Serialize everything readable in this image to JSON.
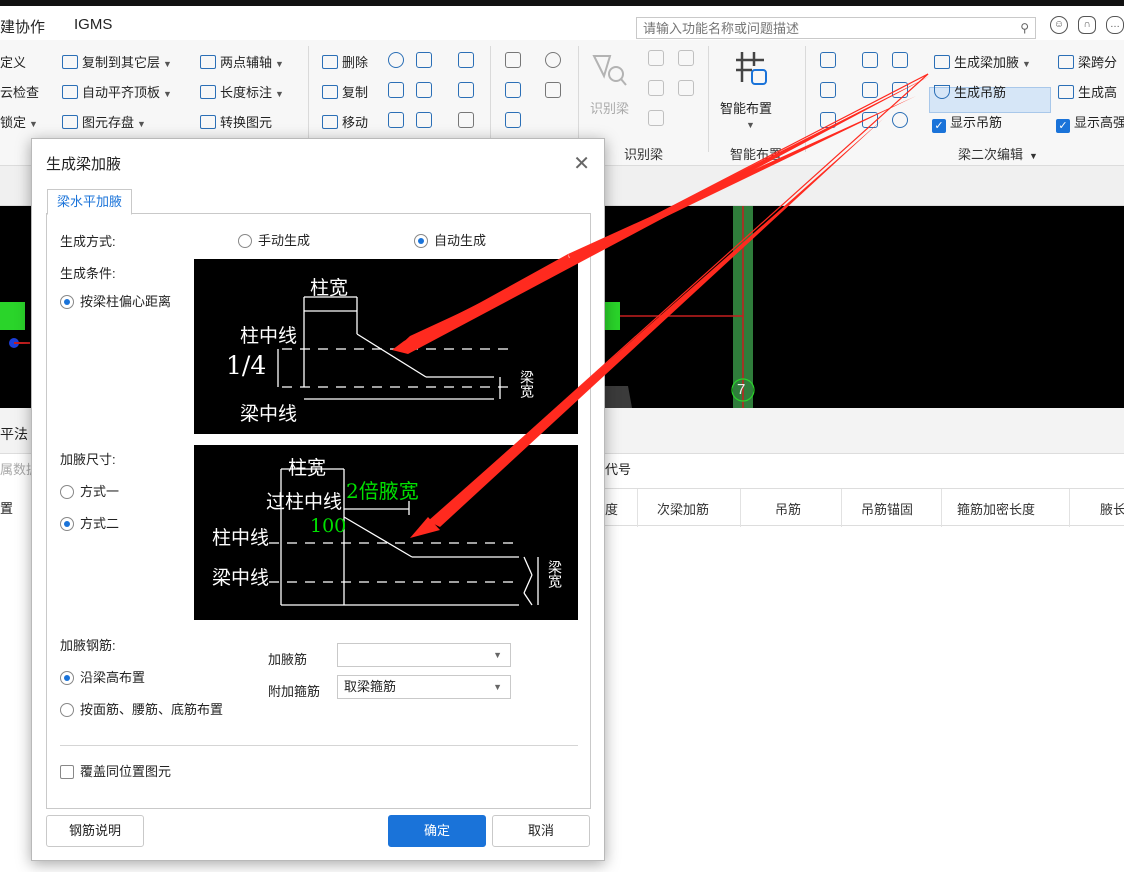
{
  "menu": {
    "items": [
      "建协作",
      "IGMS"
    ]
  },
  "search": {
    "placeholder": "请输入功能名称或问题描述"
  },
  "ribbon": {
    "col1": [
      "定义",
      "云检查",
      "锁定"
    ],
    "col2": [
      "复制到其它层",
      "自动平齐顶板",
      "图元存盘"
    ],
    "col3": [
      "两点辅轴",
      "长度标注",
      "转换图元"
    ],
    "col4": [
      "删除",
      "复制",
      "移动"
    ],
    "recognize_label": "识别梁",
    "recognize_group": "识别梁",
    "smart_layout_label": "智能布置",
    "smart_layout_group": "智能布置",
    "generate_haunch": "生成梁加腋",
    "span_split": "梁跨分",
    "generate_hanger": "生成吊筋",
    "generate_high": "生成高",
    "show_hanger": "显示吊筋",
    "show_high": "显示高强",
    "beam_edit_group": "梁二次编辑"
  },
  "canvas": {
    "axis_number": "7",
    "left_tab": "平法",
    "left_sub": "属数据",
    "left_row": "置"
  },
  "table": {
    "caption": "代号",
    "columns": [
      "度",
      "次梁加筋",
      "吊筋",
      "吊筋锚固",
      "箍筋加密长度",
      "腋长"
    ]
  },
  "dialog": {
    "title": "生成梁加腋",
    "tab": "梁水平加腋",
    "gen_method_label": "生成方式:",
    "manual": "手动生成",
    "auto": "自动生成",
    "gen_condition_label": "生成条件:",
    "condition_option": "按梁柱偏心距离",
    "haunch_size_label": "加腋尺寸:",
    "method1": "方式一",
    "method2": "方式二",
    "haunch_rebar_label": "加腋钢筋:",
    "along_height": "沿梁高布置",
    "by_bars": "按面筋、腰筋、底筋布置",
    "haunch_bar_label": "加腋筋",
    "haunch_bar_value": "",
    "extra_stirrup_label": "附加箍筋",
    "extra_stirrup_value": "取梁箍筋",
    "overwrite": "覆盖同位置图元",
    "rebar_explain": "钢筋说明",
    "ok": "确定",
    "cancel": "取消"
  },
  "diagram1": {
    "col_width": "柱宽",
    "col_center": "柱中线",
    "quarter": "1/4",
    "beam_center": "梁中线",
    "beam_width": "梁宽"
  },
  "diagram2": {
    "col_width": "柱宽",
    "through_center": "过柱中线",
    "double_width": "2倍腋宽",
    "hundred": "100",
    "col_center": "柱中线",
    "beam_center": "梁中线",
    "beam_width": "梁宽"
  },
  "colors": {
    "accent": "#1a73d9",
    "arrow": "#ff2a1f",
    "diagram_green": "#00e000"
  }
}
